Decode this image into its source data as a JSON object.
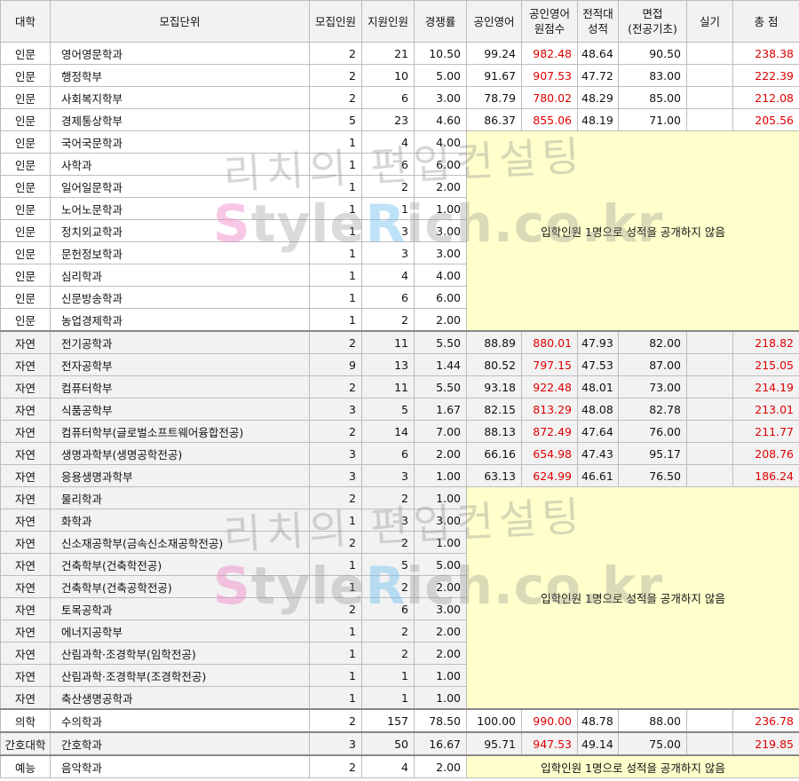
{
  "headers": [
    "대학",
    "모집단위",
    "모집인원",
    "지원인원",
    "경쟁률",
    "공인영어",
    "공인영어\n원점수",
    "전적대\n성적",
    "면접\n(전공기초)",
    "실기",
    "총 점"
  ],
  "note": "입학인원 1명으로 성적을 공개하지 않음",
  "watermark": {
    "korean": "리치의 편입컨설팅",
    "site_s": "S",
    "site_a": "tyle",
    "site_r": "R",
    "site_b": "ich.co.kr"
  },
  "rows": [
    {
      "univ": "인문",
      "unit": "영어영문학과",
      "quota": "2",
      "applicants": "21",
      "ratio": "10.50",
      "eng": "99.24",
      "eng_raw": "982.48",
      "gpa": "48.64",
      "interview": "90.50",
      "practical": "",
      "total": "238.38"
    },
    {
      "univ": "인문",
      "unit": "행정학부",
      "quota": "2",
      "applicants": "10",
      "ratio": "5.00",
      "eng": "91.67",
      "eng_raw": "907.53",
      "gpa": "47.72",
      "interview": "83.00",
      "practical": "",
      "total": "222.39"
    },
    {
      "univ": "인문",
      "unit": "사회복지학부",
      "quota": "2",
      "applicants": "6",
      "ratio": "3.00",
      "eng": "78.79",
      "eng_raw": "780.02",
      "gpa": "48.29",
      "interview": "85.00",
      "practical": "",
      "total": "212.08"
    },
    {
      "univ": "인문",
      "unit": "경제통상학부",
      "quota": "5",
      "applicants": "23",
      "ratio": "4.60",
      "eng": "86.37",
      "eng_raw": "855.06",
      "gpa": "48.19",
      "interview": "71.00",
      "practical": "",
      "total": "205.56"
    },
    {
      "univ": "인문",
      "unit": "국어국문학과",
      "quota": "1",
      "applicants": "4",
      "ratio": "4.00"
    },
    {
      "univ": "인문",
      "unit": "사학과",
      "quota": "1",
      "applicants": "6",
      "ratio": "6.00"
    },
    {
      "univ": "인문",
      "unit": "일어일문학과",
      "quota": "1",
      "applicants": "2",
      "ratio": "2.00"
    },
    {
      "univ": "인문",
      "unit": "노어노문학과",
      "quota": "1",
      "applicants": "1",
      "ratio": "1.00"
    },
    {
      "univ": "인문",
      "unit": "정치외교학과",
      "quota": "1",
      "applicants": "3",
      "ratio": "3.00"
    },
    {
      "univ": "인문",
      "unit": "문헌정보학과",
      "quota": "1",
      "applicants": "3",
      "ratio": "3.00"
    },
    {
      "univ": "인문",
      "unit": "심리학과",
      "quota": "1",
      "applicants": "4",
      "ratio": "4.00"
    },
    {
      "univ": "인문",
      "unit": "신문방송학과",
      "quota": "1",
      "applicants": "6",
      "ratio": "6.00"
    },
    {
      "univ": "인문",
      "unit": "농업경제학과",
      "quota": "1",
      "applicants": "2",
      "ratio": "2.00"
    },
    {
      "univ": "자연",
      "unit": "전기공학과",
      "quota": "2",
      "applicants": "11",
      "ratio": "5.50",
      "eng": "88.89",
      "eng_raw": "880.01",
      "gpa": "47.93",
      "interview": "82.00",
      "practical": "",
      "total": "218.82"
    },
    {
      "univ": "자연",
      "unit": "전자공학부",
      "quota": "9",
      "applicants": "13",
      "ratio": "1.44",
      "eng": "80.52",
      "eng_raw": "797.15",
      "gpa": "47.53",
      "interview": "87.00",
      "practical": "",
      "total": "215.05"
    },
    {
      "univ": "자연",
      "unit": "컴퓨터학부",
      "quota": "2",
      "applicants": "11",
      "ratio": "5.50",
      "eng": "93.18",
      "eng_raw": "922.48",
      "gpa": "48.01",
      "interview": "73.00",
      "practical": "",
      "total": "214.19"
    },
    {
      "univ": "자연",
      "unit": "식품공학부",
      "quota": "3",
      "applicants": "5",
      "ratio": "1.67",
      "eng": "82.15",
      "eng_raw": "813.29",
      "gpa": "48.08",
      "interview": "82.78",
      "practical": "",
      "total": "213.01"
    },
    {
      "univ": "자연",
      "unit": "컴퓨터학부(글로벌소프트웨어융합전공)",
      "quota": "2",
      "applicants": "14",
      "ratio": "7.00",
      "eng": "88.13",
      "eng_raw": "872.49",
      "gpa": "47.64",
      "interview": "76.00",
      "practical": "",
      "total": "211.77"
    },
    {
      "univ": "자연",
      "unit": "생명과학부(생명공학전공)",
      "quota": "3",
      "applicants": "6",
      "ratio": "2.00",
      "eng": "66.16",
      "eng_raw": "654.98",
      "gpa": "47.43",
      "interview": "95.17",
      "practical": "",
      "total": "208.76"
    },
    {
      "univ": "자연",
      "unit": "응용생명과학부",
      "quota": "3",
      "applicants": "3",
      "ratio": "1.00",
      "eng": "63.13",
      "eng_raw": "624.99",
      "gpa": "46.61",
      "interview": "76.50",
      "practical": "",
      "total": "186.24"
    },
    {
      "univ": "자연",
      "unit": "물리학과",
      "quota": "2",
      "applicants": "2",
      "ratio": "1.00"
    },
    {
      "univ": "자연",
      "unit": "화학과",
      "quota": "1",
      "applicants": "3",
      "ratio": "3.00"
    },
    {
      "univ": "자연",
      "unit": "신소재공학부(금속신소재공학전공)",
      "quota": "2",
      "applicants": "2",
      "ratio": "1.00"
    },
    {
      "univ": "자연",
      "unit": "건축학부(건축학전공)",
      "quota": "1",
      "applicants": "5",
      "ratio": "5.00"
    },
    {
      "univ": "자연",
      "unit": "건축학부(건축공학전공)",
      "quota": "1",
      "applicants": "2",
      "ratio": "2.00"
    },
    {
      "univ": "자연",
      "unit": "토목공학과",
      "quota": "2",
      "applicants": "6",
      "ratio": "3.00"
    },
    {
      "univ": "자연",
      "unit": "에너지공학부",
      "quota": "1",
      "applicants": "2",
      "ratio": "2.00"
    },
    {
      "univ": "자연",
      "unit": "산림과학·조경학부(임학전공)",
      "quota": "1",
      "applicants": "2",
      "ratio": "2.00"
    },
    {
      "univ": "자연",
      "unit": "산림과학·조경학부(조경학전공)",
      "quota": "1",
      "applicants": "1",
      "ratio": "1.00"
    },
    {
      "univ": "자연",
      "unit": "축산생명공학과",
      "quota": "1",
      "applicants": "1",
      "ratio": "1.00"
    },
    {
      "univ": "의학",
      "unit": "수의학과",
      "quota": "2",
      "applicants": "157",
      "ratio": "78.50",
      "eng": "100.00",
      "eng_raw": "990.00",
      "gpa": "48.78",
      "interview": "88.00",
      "practical": "",
      "total": "236.78"
    },
    {
      "univ": "간호대학",
      "unit": "간호학과",
      "quota": "3",
      "applicants": "50",
      "ratio": "16.67",
      "eng": "95.71",
      "eng_raw": "947.53",
      "gpa": "49.14",
      "interview": "75.00",
      "practical": "",
      "total": "219.85"
    },
    {
      "univ": "예능",
      "unit": "음악학과",
      "quota": "2",
      "applicants": "4",
      "ratio": "2.00"
    }
  ]
}
